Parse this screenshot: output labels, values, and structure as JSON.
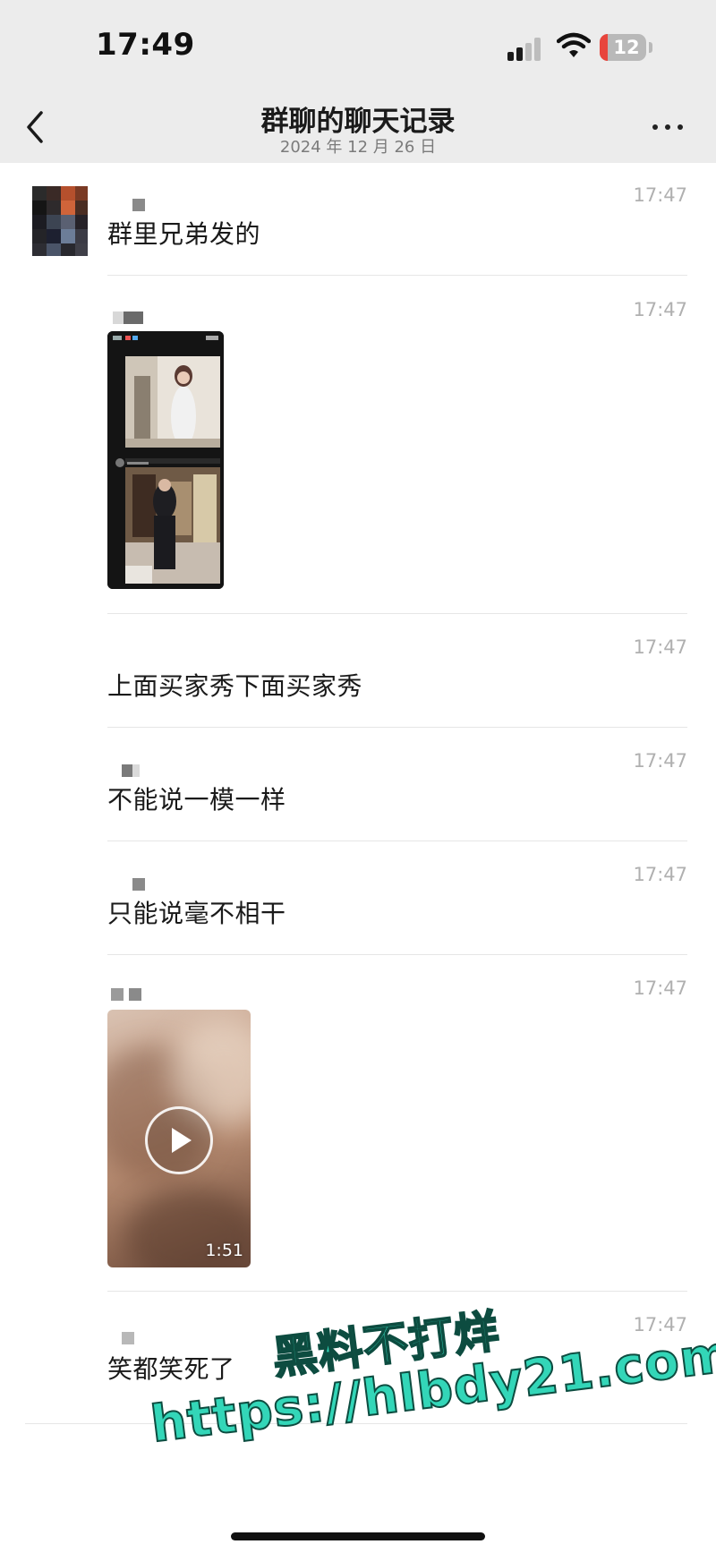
{
  "status_bar": {
    "time": "17:49",
    "battery_level": "12",
    "icons": [
      "signal-icon",
      "wifi-icon",
      "battery-icon"
    ]
  },
  "nav": {
    "title": "群聊的聊天记录",
    "subtitle": "2024 年 12 月 26 日",
    "icons": [
      "back-icon",
      "more-icon"
    ]
  },
  "messages": [
    {
      "type": "text",
      "time": "17:47",
      "text": "群里兄弟发的"
    },
    {
      "type": "image",
      "time": "17:47"
    },
    {
      "type": "text",
      "time": "17:47",
      "text": "上面买家秀下面买家秀"
    },
    {
      "type": "text",
      "time": "17:47",
      "text": "不能说一模一样"
    },
    {
      "type": "text",
      "time": "17:47",
      "text": "只能说毫不相干"
    },
    {
      "type": "video",
      "time": "17:47",
      "duration": "1:51"
    },
    {
      "type": "text",
      "time": "17:47",
      "text": "笑都笑死了"
    }
  ],
  "watermark": {
    "line1": "黑料不打烊",
    "line2": "https://hlbdy21.com"
  },
  "colors": {
    "header_bg": "#ececec",
    "watermark": "#33d6b8",
    "battery_low": "#e8453c",
    "timestamp": "#b0b0b0"
  }
}
